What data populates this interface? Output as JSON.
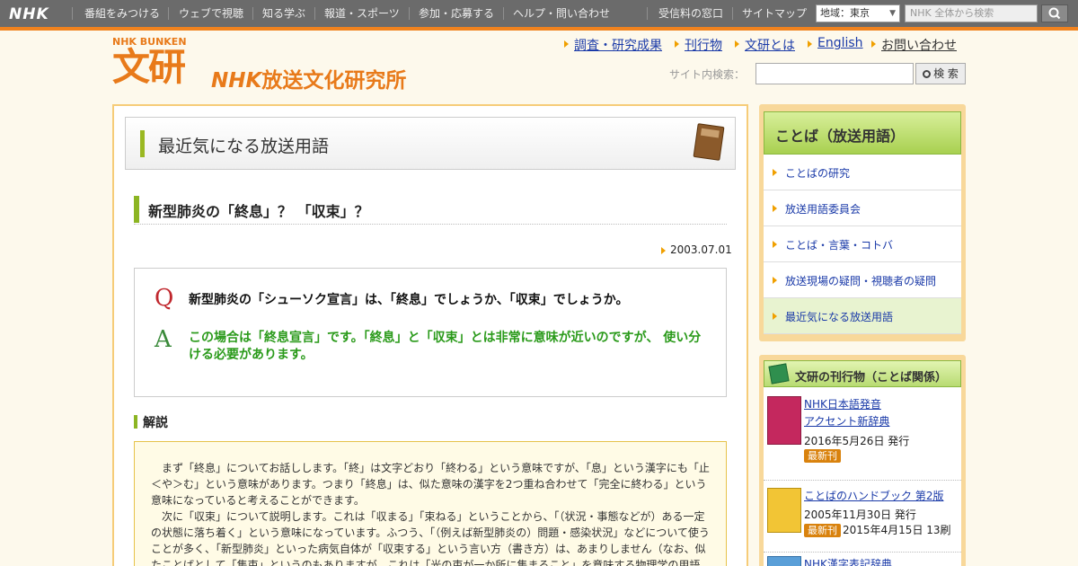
{
  "global_nav": {
    "logo": "NHK",
    "items": [
      "番組をみつける",
      "ウェブで視聴",
      "知る学ぶ",
      "報道・スポーツ",
      "参加・応募する",
      "ヘルプ・問い合わせ"
    ],
    "right_items": [
      "受信料の窓口",
      "サイトマップ"
    ],
    "region_label": "地域：",
    "region_value": "東京",
    "search_placeholder": "NHK 全体から検索"
  },
  "header": {
    "logo_small": "NHK BUNKEN",
    "logo_mark": "文研",
    "org_nhk": "NHK",
    "org_rest": "放送文化研究所",
    "links": [
      "調査・研究成果",
      "刊行物",
      "文研とは",
      "English"
    ],
    "contact": "お問い合わせ",
    "site_search_label": "サイト内検索：",
    "site_search_button": "検 索"
  },
  "main": {
    "section_title": "最近気になる放送用語",
    "article_title": "新型肺炎の「終息」？ 「収束」？",
    "date": "2003.07.01",
    "q_letter": "Q",
    "question": "新型肺炎の「シューソク宣言」は、「終息」でしょうか、「収束」でしょうか。",
    "a_letter": "A",
    "answer": "この場合は「終息宣言」です。「終息」と「収束」とは非常に意味が近いのですが、 使い分ける必要があります。",
    "explanation_heading": "解説",
    "explanation": [
      "まず「終息」についてお話しします。「終」は文字どおり「終わる」という意味ですが、「息」という漢字にも「止＜や＞む」という意味があります。つまり「終息」は、似た意味の漢字を2つ重ね合わせて「完全に終わる」という意味になっていると考えることができます。",
      "次に「収束」について説明します。これは「収まる」「束ねる」ということから、「（状況・事態などが）ある一定の状態に落ち着く」という意味になっています。ふつう、「（例えば新型肺炎の）問題・感染状況」などについて使うことが多く、「新型肺炎」といった病気自体が「収束する」という言い方（書き方）は、あまりしません（なお、似たことばとして「集束」というのもありますが、これは「光の束が一か所に集まること」を意味する物理学の用語です。）"
    ]
  },
  "sidebar": {
    "title": "ことば（放送用語）",
    "items": [
      "ことばの研究",
      "放送用語委員会",
      "ことば・言葉・コトバ",
      "放送現場の疑問・視聴者の疑問",
      "最近気になる放送用語"
    ],
    "publications_title": "文研の刊行物（ことば関係）",
    "publications": [
      {
        "title_line1": "NHK日本語発音",
        "title_line2": "アクセント新辞典",
        "date": "2016年5月26日 発行",
        "badge": "最新刊"
      },
      {
        "title_line1": "ことばのハンドブック 第2版",
        "date": "2005年11月30日 発行",
        "badge": "最新刊",
        "reprint": "2015年4月15日 13刷"
      },
      {
        "title_line1": "NHK漢字表記辞典"
      }
    ]
  },
  "colors": {
    "accent_orange": "#f0821e",
    "link_blue": "#1a3aa8",
    "answer_green": "#2a9a1a",
    "q_red": "#c0272d",
    "bar_green": "#8cb523"
  }
}
